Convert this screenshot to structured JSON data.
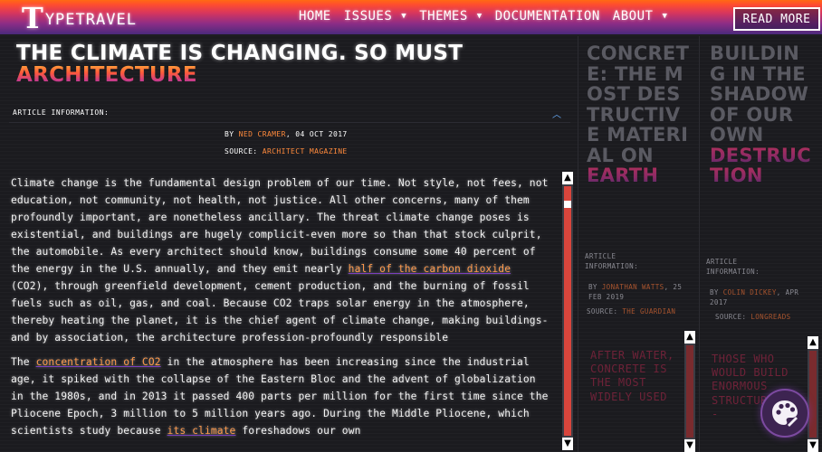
{
  "nav": {
    "logo_t": "T",
    "logo_rest": "YPETRAVEL",
    "menu": [
      {
        "label": "HOME",
        "has_caret": false
      },
      {
        "label": "ISSUES",
        "has_caret": true
      },
      {
        "label": "THEMES",
        "has_caret": true
      },
      {
        "label": "DOCUMENTATION",
        "has_caret": false
      },
      {
        "label": "ABOUT",
        "has_caret": true
      }
    ],
    "caret": "▼",
    "read_more": "READ MORE"
  },
  "article": {
    "title_line1": "THE CLIMATE IS CHANGING. SO MUST",
    "title_line2": "ARCHITECTURE",
    "info_label": "ARTICLE INFORMATION:",
    "info_chevron": "︿",
    "by_prefix": "BY",
    "author": "NED CRAMER",
    "date": ", 04 OCT 2017",
    "source_prefix": "SOURCE:",
    "source": "ARCHITECT MAGAZINE",
    "p1_a": "Climate change is the fundamental design problem of our time. Not style, not fees, not education, not community, not health, not justice. All other concerns, many of them profoundly important, are nonetheless ancillary. The threat climate change poses is existential, and buildings are hugely complicit-even more so than that stock culprit, the automobile. As every architect should know, buildings consume some 40 percent of the energy in the U.S. annually, and they emit nearly ",
    "p1_link": "half of the carbon dioxide",
    "p1_b": " (CO2), through greenfield development, cement production, and the burning of fossil fuels such as oil, gas, and coal. Because CO2 traps solar energy in the atmosphere, thereby heating the planet, it is the chief agent of climate change, making buildings-and by association, the architecture profession-profoundly responsible",
    "p2_a": "The ",
    "p2_link": "concentration of CO2",
    "p2_b": " in the atmosphere has been increasing since the industrial age, it spiked with the collapse of the Eastern Bloc and the advent of globalization in the 1980s, and in 2013 it passed 400 parts per million for the first time since the Pliocene Epoch, 3 million to 5 million years ago. During the Middle Pliocene, which scientists study because ",
    "p2_link2": "its climate",
    "p2_c": " foreshadows our own"
  },
  "scroll": {
    "up": "▲",
    "down": "▼"
  },
  "cards": [
    {
      "title_plain": "CONCRETE: THE MOST DESTRUCTIVE MATERIAL ON",
      "title_accent": "EARTH",
      "info_label": "ARTICLE INFORMATION:",
      "by_prefix": "BY",
      "author": "JONATHAN WATTS",
      "date": ", 25 FEB 2019",
      "source_prefix": "SOURCE:",
      "source": "THE GUARDIAN",
      "excerpt": "AFTER WATER, CONCRETE IS THE MOST WIDELY USED"
    },
    {
      "title_plain": "BUILDING IN THE SHADOW OF OUR OWN",
      "title_accent": "DESTRUCTION",
      "info_label": "ARTICLE INFORMATION:",
      "by_prefix": "BY",
      "author": "COLIN DICKEY",
      "date": ", APR 2017",
      "source_prefix": "SOURCE:",
      "source": "LONGREADS",
      "excerpt": "THOSE WHO WOULD BUILD ENORMOUS STRUCTURES -"
    }
  ],
  "colors": {
    "accent_orange": "#ff8a3c",
    "scroll_track": "#d8453c",
    "nav_top": "#ff6a13",
    "nav_bottom": "#4b2a7c"
  },
  "icons": {
    "palette": "palette-icon"
  }
}
